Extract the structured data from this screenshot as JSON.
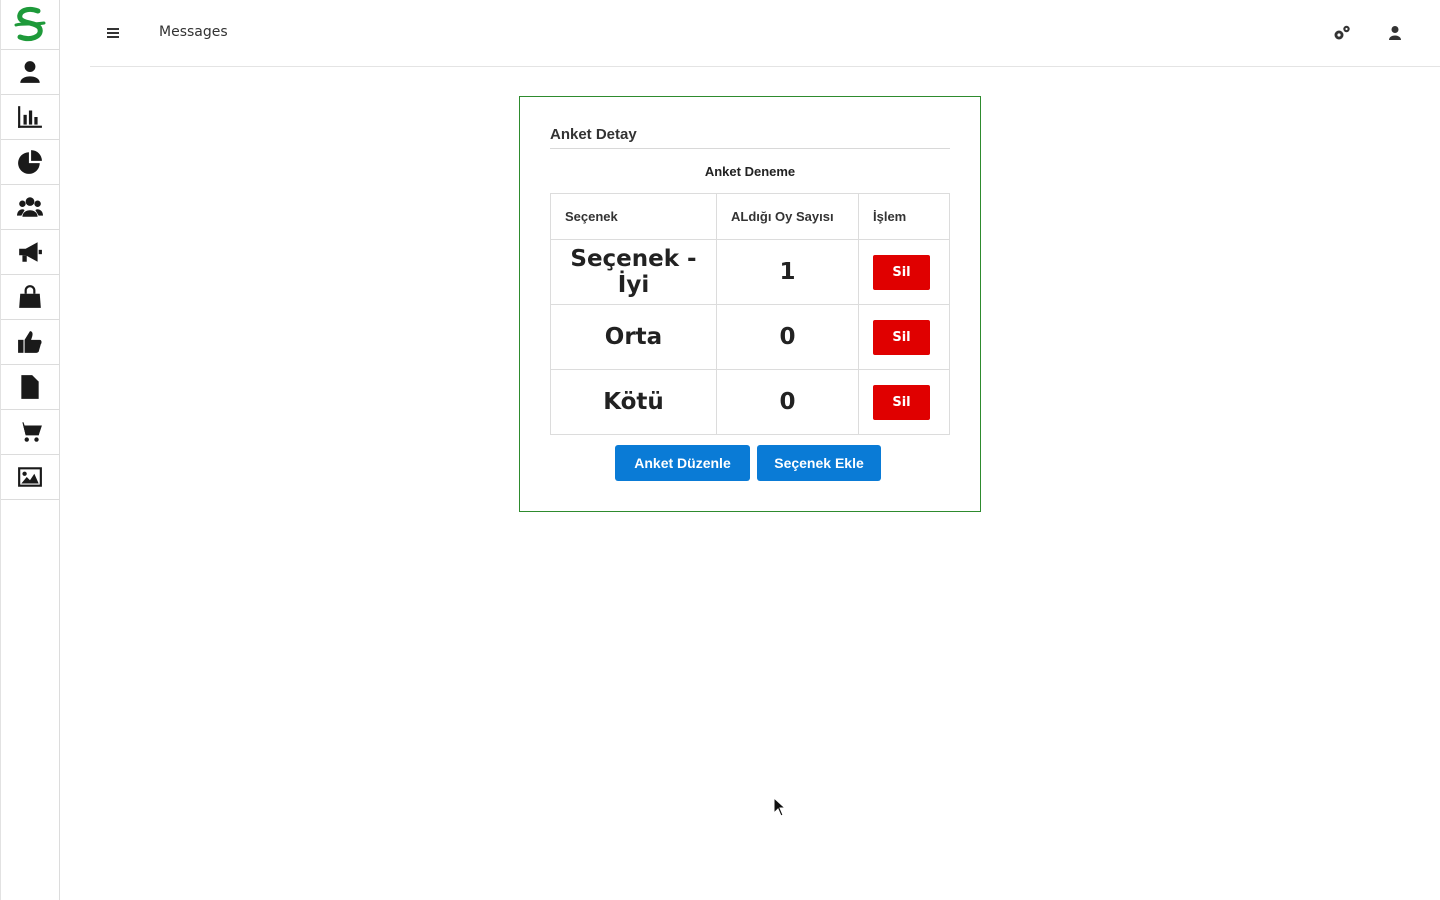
{
  "colors": {
    "brand_green": "#1e9a3a",
    "card_border": "#2e8b2e",
    "danger": "#e00000",
    "primary": "#0a7bd6"
  },
  "sidebar": {
    "logo_icon": "brand-logo-icon",
    "items": [
      {
        "icon": "user-icon"
      },
      {
        "icon": "bar-chart-icon"
      },
      {
        "icon": "pie-chart-icon"
      },
      {
        "icon": "users-icon"
      },
      {
        "icon": "megaphone-icon"
      },
      {
        "icon": "shopping-bag-icon"
      },
      {
        "icon": "thumbs-up-icon"
      },
      {
        "icon": "file-icon"
      },
      {
        "icon": "cart-icon"
      },
      {
        "icon": "image-icon"
      }
    ]
  },
  "header": {
    "title": "Messages",
    "menu_icon": "hamburger-icon",
    "settings_icon": "gears-icon",
    "user_icon": "user-icon"
  },
  "card": {
    "title": "Anket Detay",
    "survey_name": "Anket Deneme",
    "table": {
      "columns": [
        "Seçenek",
        "ALdığı Oy Sayısı",
        "İşlem"
      ],
      "rows": [
        {
          "option": "Seçenek - İyi",
          "votes": "1",
          "action": "Sil"
        },
        {
          "option": "Orta",
          "votes": "0",
          "action": "Sil"
        },
        {
          "option": "Kötü",
          "votes": "0",
          "action": "Sil"
        }
      ]
    },
    "edit_button": "Anket Düzenle",
    "add_option_button": "Seçenek Ekle"
  }
}
